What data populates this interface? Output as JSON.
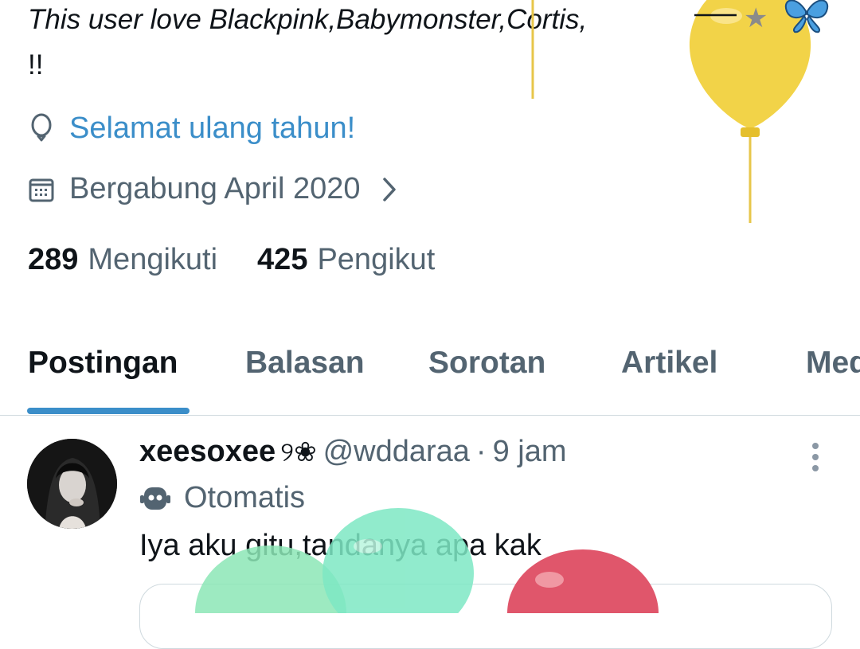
{
  "profile": {
    "bio_line1": "This user love Blackpink,Babymonster,Cortis,",
    "bio_line2": "!!",
    "birthday_text": "Selamat ulang tahun!",
    "joined_text": "Bergabung April 2020",
    "following_count": "289",
    "following_label": "Mengikuti",
    "followers_count": "425",
    "followers_label": "Pengikut"
  },
  "tabs": [
    {
      "label": "Postingan",
      "active": true
    },
    {
      "label": "Balasan"
    },
    {
      "label": "Sorotan"
    },
    {
      "label": "Artikel"
    },
    {
      "label": "Media"
    }
  ],
  "post": {
    "display_name": "xeesoxee",
    "name_deco": "୨❀",
    "handle": "@wddaraa",
    "separator": "·",
    "time": "9 jam",
    "automated_label": "Otomatis",
    "text": "Iya aku gitu,tandanya apa kak"
  },
  "icons": {
    "birthday": "balloon-icon",
    "joined": "calendar-icon",
    "joined_more": "chevron-right-icon",
    "post_more": "more-vertical-icon",
    "automated": "bot-icon",
    "bio_emoji": "butterfly-icon"
  },
  "colors": {
    "accent": "#3b8ec9",
    "text_primary": "#0f1419",
    "text_secondary": "#536471",
    "divider": "#cfd9de"
  }
}
